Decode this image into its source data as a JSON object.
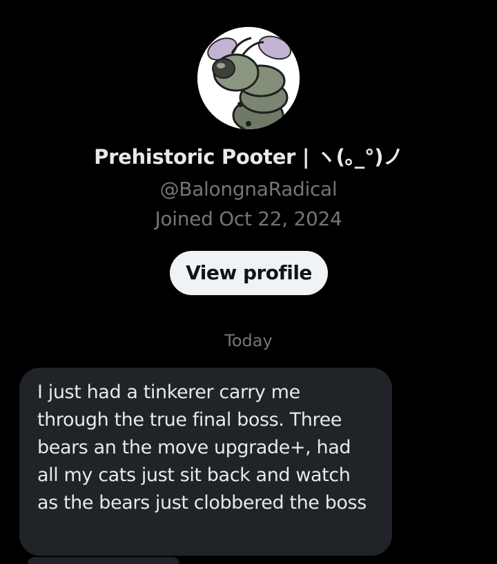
{
  "profile": {
    "display_name": "Prehistoric Pooter | ヽ(｡_°)ノ",
    "handle": "@BalongnaRadical",
    "joined": "Joined Oct 22, 2024",
    "view_profile_label": "View profile",
    "avatar_icon": "cartoon-grub-avatar"
  },
  "conversation": {
    "date_separator": "Today",
    "messages": [
      {
        "text": "I just had a tinkerer carry me through the true final boss. Three bears an the move upgrade+, had all my cats just sit back and watch as the bears just clobbered the boss"
      }
    ]
  },
  "colors": {
    "background": "#000000",
    "primary_text": "#e7e9ea",
    "secondary_text": "#71767b",
    "button_bg": "#eff3f4",
    "bubble_bg": "#202327"
  }
}
